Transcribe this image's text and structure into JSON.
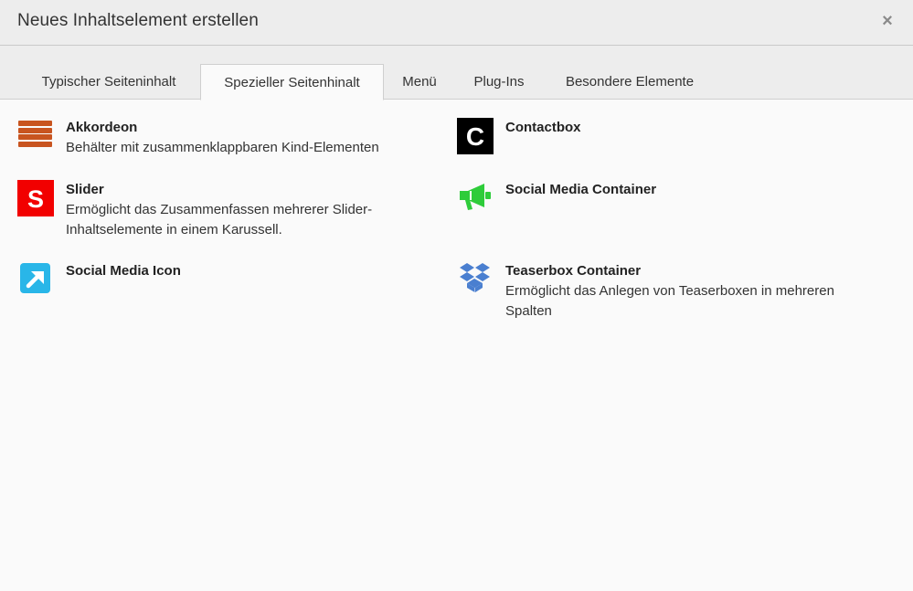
{
  "dialog": {
    "title": "Neues Inhaltselement erstellen",
    "close_label": "×"
  },
  "tabs": [
    {
      "label": "Typischer Seiteninhalt",
      "active": false
    },
    {
      "label": "Spezieller Seitenhinalt",
      "active": true
    },
    {
      "label": "Menü",
      "active": false
    },
    {
      "label": "Plug-Ins",
      "active": false
    },
    {
      "label": "Besondere Elemente",
      "active": false
    }
  ],
  "elements": {
    "akkordeon": {
      "title": "Akkordeon",
      "description": "Behälter mit zusammenklappbaren Kind-Elementen",
      "icon": "accordion-icon",
      "color": "#c8541f"
    },
    "contactbox": {
      "title": "Contactbox",
      "description": "",
      "icon": "contactbox-c-icon",
      "color": "#000000",
      "glyph": "C"
    },
    "slider": {
      "title": "Slider",
      "description_line1": "Ermöglicht das Zusammenfassen mehrerer Slider-",
      "description_line2": "Inhaltselemente in einem Karussell.",
      "icon": "slider-s-icon",
      "color": "#f20000",
      "glyph": "S"
    },
    "social_media_container": {
      "title": "Social Media Container",
      "description": "",
      "icon": "megaphone-icon",
      "color": "#2ecc3a"
    },
    "social_media_icon": {
      "title": "Social Media Icon",
      "description": "",
      "icon": "arrow-up-right-icon",
      "color": "#29b6e8"
    },
    "teaserbox_container": {
      "title": "Teaserbox Container",
      "description_line1": "Ermöglicht das Anlegen von Teaserboxen in mehreren",
      "description_line2": "Spalten",
      "icon": "dropbox-icon",
      "color": "#4a7fd0"
    }
  }
}
